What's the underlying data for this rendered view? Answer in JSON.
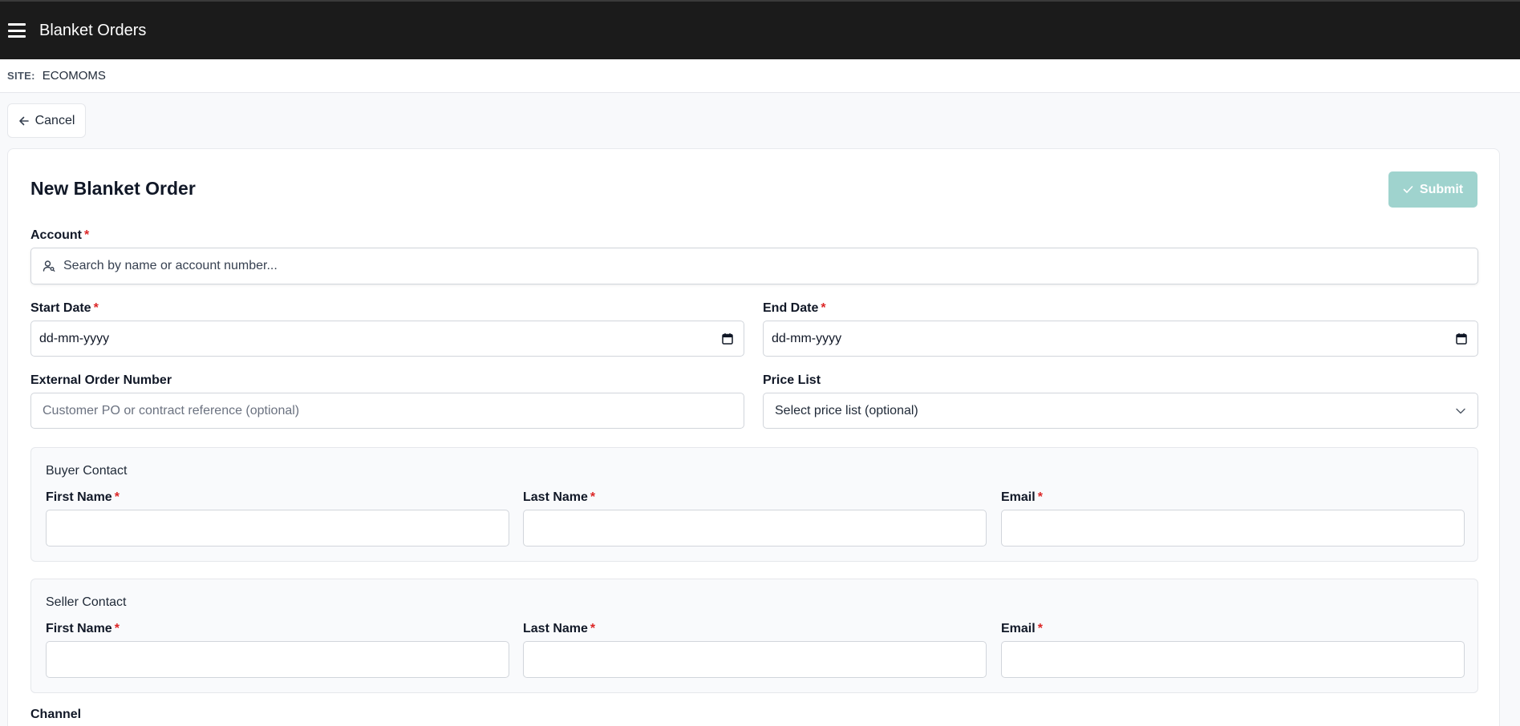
{
  "header": {
    "title": "Blanket Orders",
    "menu_icon": "hamburger-menu-icon"
  },
  "site": {
    "label": "SITE:",
    "value": "ECOMOMS"
  },
  "actions": {
    "cancel_label": "Cancel",
    "submit_label": "Submit"
  },
  "form": {
    "title": "New Blanket Order",
    "account": {
      "label": "Account",
      "required_mark": "*",
      "placeholder": "Search by name or account number..."
    },
    "start_date": {
      "label": "Start Date",
      "required_mark": "*",
      "value": "dd-mm-yyyy"
    },
    "end_date": {
      "label": "End Date",
      "required_mark": "*",
      "value": "dd-mm-yyyy"
    },
    "external_order_number": {
      "label": "External Order Number",
      "placeholder": "Customer PO or contract reference (optional)"
    },
    "price_list": {
      "label": "Price List",
      "selected": "Select price list (optional)"
    },
    "buyer_contact": {
      "title": "Buyer Contact",
      "first_name_label": "First Name",
      "last_name_label": "Last Name",
      "email_label": "Email",
      "required_mark": "*"
    },
    "seller_contact": {
      "title": "Seller Contact",
      "first_name_label": "First Name",
      "last_name_label": "Last Name",
      "email_label": "Email",
      "required_mark": "*"
    },
    "channel": {
      "label": "Channel"
    }
  },
  "colors": {
    "topbar": "#1b1b1b",
    "submit_disabled": "#9fd3ce",
    "required": "#dc2626"
  }
}
